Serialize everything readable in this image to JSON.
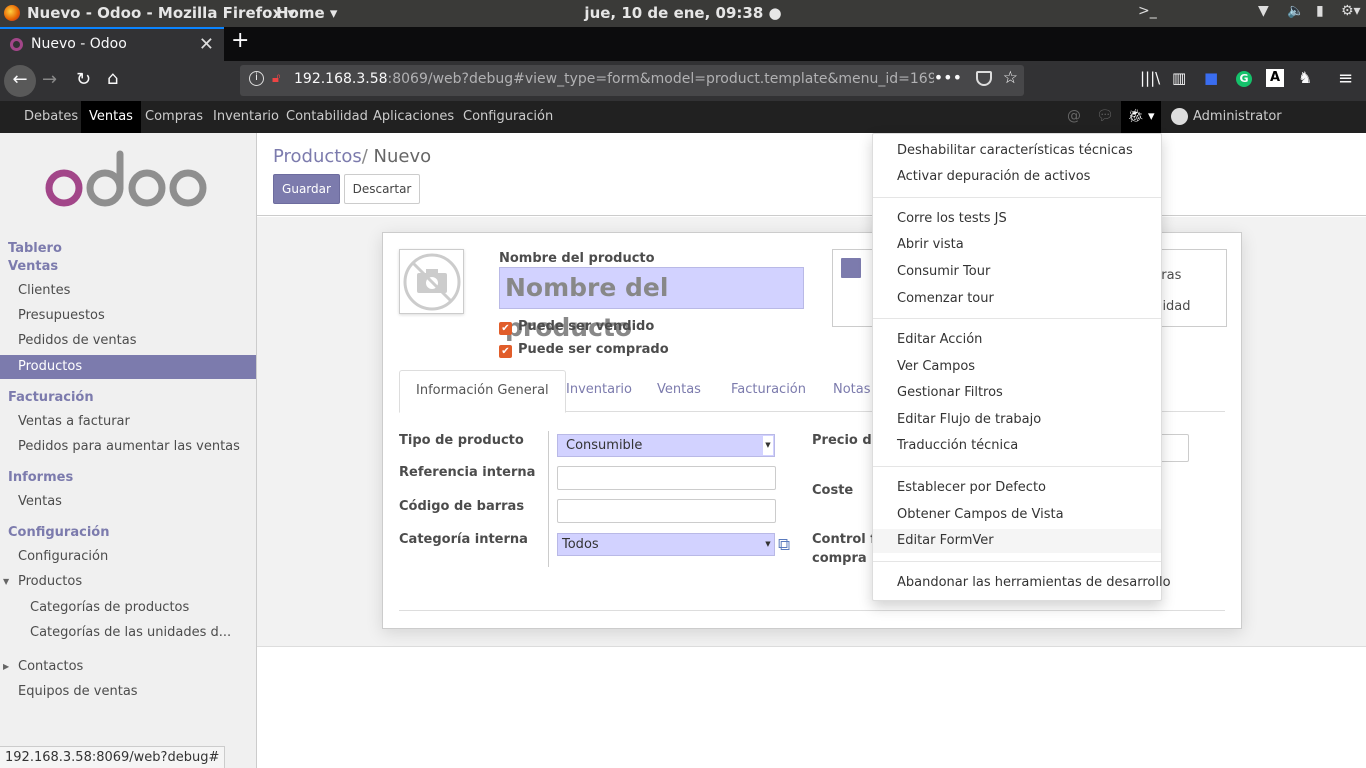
{
  "system": {
    "app_title": "Nuevo - Odoo - Mozilla Firefox ▾",
    "home": "Home ▾",
    "clock": "jue, 10 de ene, 09:38"
  },
  "browser": {
    "tab_title": "Nuevo - Odoo",
    "url_host": "192.168.3.58",
    "url_rest": ":8069/web?debug#view_type=form&model=product.template&menu_id=169&a",
    "status_url": "192.168.3.58:8069/web?debug#"
  },
  "odoo_nav": {
    "menus": [
      "Debates",
      "Ventas",
      "Compras",
      "Inventario",
      "Contabilidad",
      "Aplicaciones",
      "Configuración"
    ],
    "active": "Ventas",
    "user": "Administrator (empresa..."
  },
  "sidebar": {
    "logo_text": "odoo",
    "items": [
      {
        "label": "Tablero",
        "kind": "section"
      },
      {
        "label": "Ventas",
        "kind": "section"
      },
      {
        "label": "Clientes",
        "kind": "item"
      },
      {
        "label": "Presupuestos",
        "kind": "item"
      },
      {
        "label": "Pedidos de ventas",
        "kind": "item"
      },
      {
        "label": "Productos",
        "kind": "item",
        "active": true
      },
      {
        "label": "Facturación",
        "kind": "section"
      },
      {
        "label": "Ventas a facturar",
        "kind": "item"
      },
      {
        "label": "Pedidos para aumentar las ventas",
        "kind": "item"
      },
      {
        "label": "Informes",
        "kind": "section"
      },
      {
        "label": "Ventas",
        "kind": "item"
      },
      {
        "label": "Configuración",
        "kind": "section"
      },
      {
        "label": "Configuración",
        "kind": "item"
      },
      {
        "label": "Productos",
        "kind": "item",
        "expanded": true
      },
      {
        "label": "Categorías de productos",
        "kind": "subitem"
      },
      {
        "label": "Categorías de las unidades d...",
        "kind": "subitem"
      },
      {
        "label": "Contactos",
        "kind": "item",
        "collapsed": true
      },
      {
        "label": "Equipos de ventas",
        "kind": "item"
      }
    ]
  },
  "control_panel": {
    "breadcrumb_parent": "Productos",
    "breadcrumb_sep": "/",
    "breadcrumb_current": "Nuevo",
    "save_label": "Guardar",
    "discard_label": "Descartar"
  },
  "form": {
    "name_label": "Nombre del producto",
    "name_placeholder": "Nombre del producto",
    "can_be_sold": "Puede ser vendido",
    "can_be_purchased": "Puede ser comprado",
    "smart_button_1": "pras",
    "smart_button_2": "abilidad",
    "tabs": [
      "Información General",
      "Inventario",
      "Ventas",
      "Facturación",
      "Notas"
    ],
    "active_tab": "Información General",
    "fields": {
      "type_label": "Tipo de producto",
      "type_value": "Consumible",
      "ref_label": "Referencia interna",
      "barcode_label": "Código de barras",
      "categ_label": "Categoría interna",
      "categ_value": "Todos",
      "price_label": "Precio de",
      "cost_label": "Coste",
      "control_label_1": "Control fa",
      "control_label_2": "compra"
    }
  },
  "debug_menu": {
    "groups": [
      [
        "Deshabilitar características técnicas",
        "Activar depuración de activos"
      ],
      [
        "Corre los tests JS",
        "Abrir vista",
        "Consumir Tour",
        "Comenzar tour"
      ],
      [
        "Editar Acción",
        "Ver Campos",
        "Gestionar Filtros",
        "Editar Flujo de trabajo",
        "Traducción técnica"
      ],
      [
        "Establecer por Defecto",
        "Obtener Campos de Vista",
        "Editar FormVer"
      ],
      [
        "Abandonar las herramientas de desarrollo"
      ]
    ],
    "hovered": "Editar FormVer"
  },
  "colors": {
    "primary": "#7c7bad",
    "required_field": "#d2d2ff",
    "checkbox": "#e15d2a"
  }
}
